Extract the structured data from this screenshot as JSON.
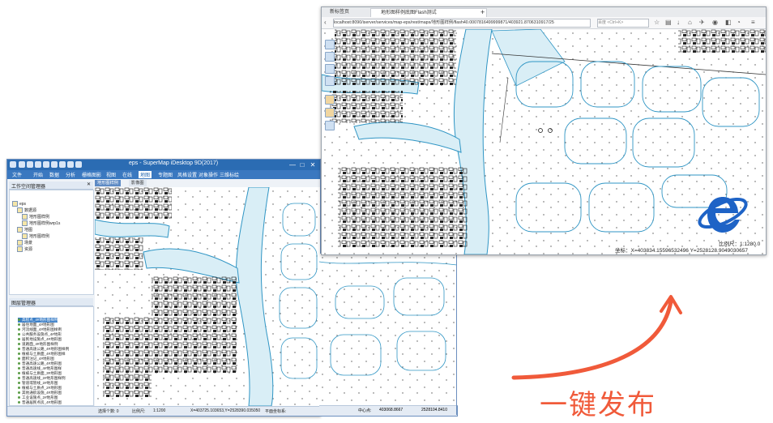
{
  "desktop_app": {
    "title": "eps - SuperMap iDesktop 9D(2017)",
    "menu": [
      "文件",
      "开始",
      "数据",
      "分析",
      "栅格图影",
      "视图",
      "在线",
      "地图",
      "专题图",
      "风格设置",
      "对象操作",
      "三维标绘"
    ],
    "map_tabs": [
      "地形图样例",
      "影像图"
    ],
    "workspace_panel": {
      "title": "工作空间管理器",
      "tree": [
        "eps",
        "数据源",
        "地形图样例",
        "地形图样例wrp1s",
        "地图",
        "地形图样例",
        "场景",
        "资源"
      ]
    },
    "layer_panel": {
      "title": "图层管理器",
      "layers": [
        "高程点_4#地形图样例",
        "居住地面_4#地形图",
        "河流线面_4#地形图样例",
        "公共服务设施点_4#地形",
        "居民地设施点_4#地形图",
        "道路面_4#地形图样例",
        "普通高速公路_4#地形图样例",
        "植被与土质面_4#地形图样",
        "面积注记_4#地形图",
        "普通高速公路_4#地形图",
        "普通高速线_4#地形图样",
        "植被与土质面_3#地形图",
        "普通高速线_2#地形图样例",
        "管道或管线_2#地形图",
        "植被与土质点_2#地形图",
        "其他通航设施_4#地形图",
        "工业设施点_2#地形图",
        "普通居民点房_4#地形图",
        "公共服务设施点_4#地形图"
      ]
    },
    "status": {
      "select_label": "选择个数: 0",
      "scale_label": "比例尺:",
      "scale_value": "1:1200",
      "coords": "X=403725.103653,Y=2528390.035050",
      "proj_label": "平面坐标系:",
      "center_label": "中心点:",
      "center_x": "403068.8667",
      "center_y": "2528104.8410"
    },
    "window_controls": [
      "—",
      "□",
      "✕"
    ]
  },
  "browser": {
    "tabs": [
      "新标签页",
      "地形图样例底图Flash测试"
    ],
    "new_tab": "+",
    "url": "localhost:8090/iserver/services/map-eps/rest/maps/地形图样例/flash40.0007816499999871/403921.8706310917/25",
    "search_placeholder": "百度 <Ctrl+K>",
    "map_tools": [
      "pan",
      "zoom-in",
      "zoom-out",
      "full-extent",
      "measure",
      "clear"
    ],
    "scale_text": "比例尺：1:1280.0",
    "coord_text": "坐标：X=403834.15596532496 Y=2528128.9049030657"
  },
  "annotation": {
    "cta": "一键发布"
  },
  "colors": {
    "arrow": "#f05a3a",
    "ie_logo": "#1e63c6",
    "idesktop_logo": "#1c86d6",
    "river_fill": "#d9eef6",
    "river_outline": "#2f95c4",
    "title_bar": "#2b6cb3"
  }
}
